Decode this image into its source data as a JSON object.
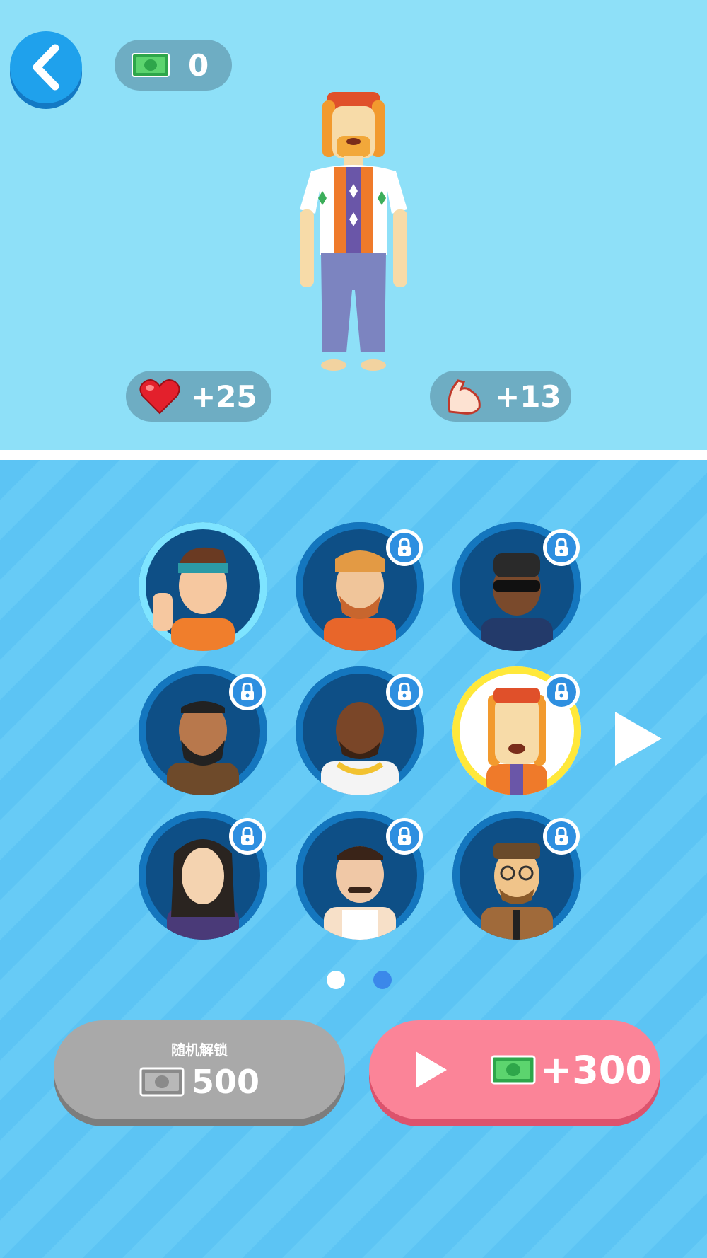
{
  "header": {
    "cash": "0"
  },
  "stats": {
    "health": "+25",
    "strength": "+13"
  },
  "characters": [
    {
      "name": "headband-guy",
      "state": "owned"
    },
    {
      "name": "bearded-redhead",
      "state": "locked"
    },
    {
      "name": "sunglasses-hat-guy",
      "state": "locked"
    },
    {
      "name": "bearded-brown-jacket",
      "state": "locked"
    },
    {
      "name": "gold-chain-guy",
      "state": "locked"
    },
    {
      "name": "redhead-bandana",
      "state": "locked",
      "selected": true
    },
    {
      "name": "long-hair-guy",
      "state": "locked"
    },
    {
      "name": "mustache-tank-top",
      "state": "locked"
    },
    {
      "name": "glasses-suit-guy",
      "state": "locked"
    }
  ],
  "pagination": {
    "total": 2,
    "current": 2
  },
  "buttons": {
    "random_unlock_label": "随机解锁",
    "random_unlock_price": "500",
    "ad_reward": "+300"
  },
  "colors": {
    "sky": "#8ee0f8",
    "panel": "#5cc4f4",
    "ad_button": "#fb8498",
    "random_button": "#a9a9a9",
    "selected_ring": "#ffe83a"
  }
}
